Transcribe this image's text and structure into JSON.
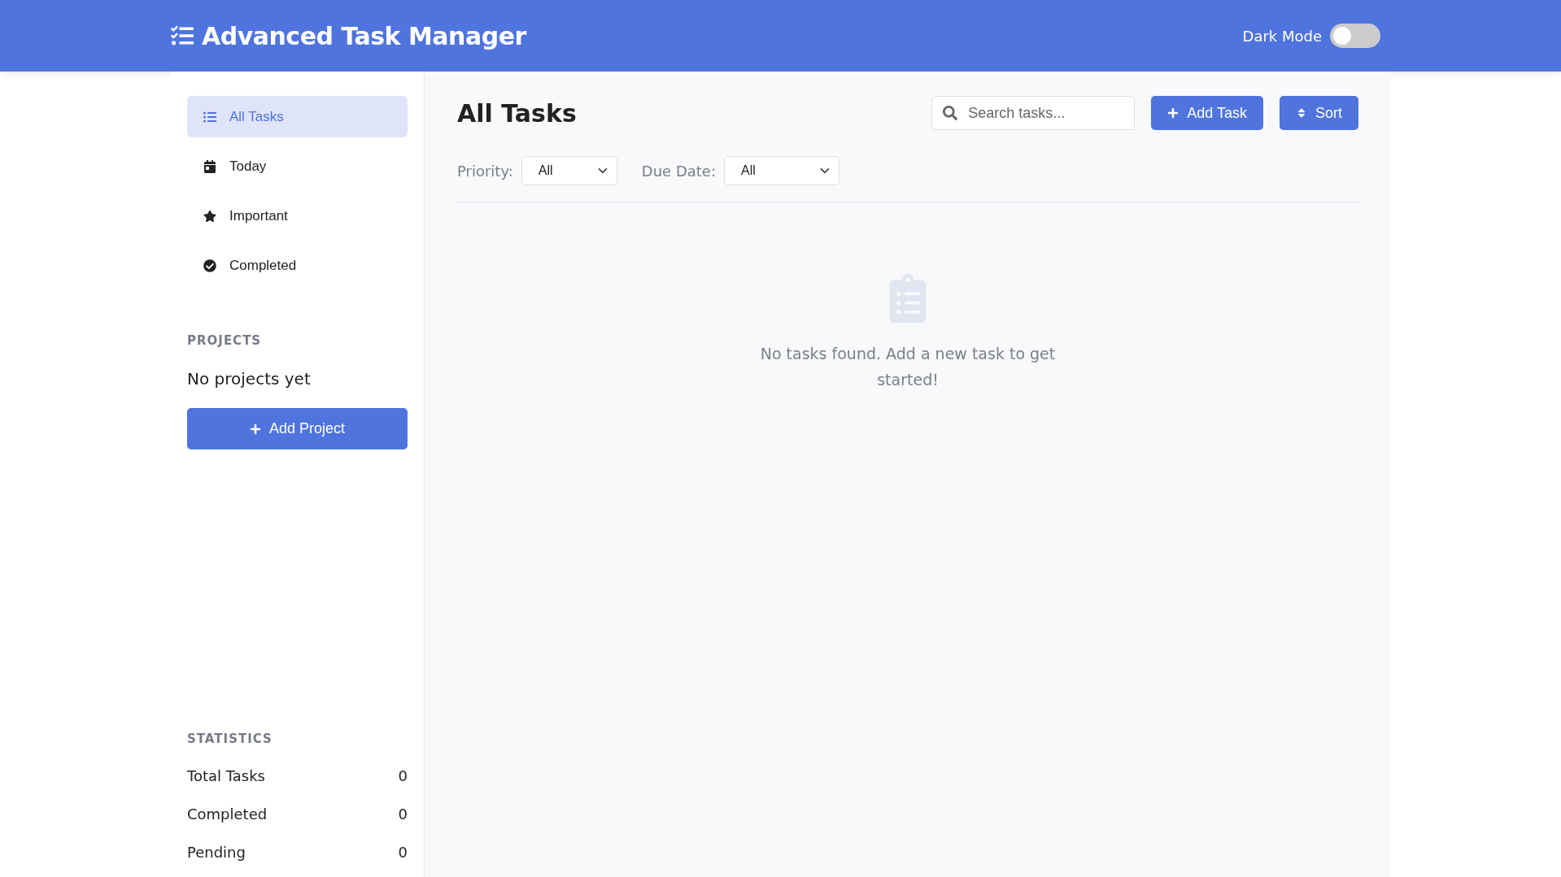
{
  "header": {
    "title": "Advanced Task Manager",
    "dark_mode": {
      "label": "Dark Mode",
      "on": false
    }
  },
  "sidebar": {
    "nav": [
      {
        "label": "All Tasks",
        "selected": true
      },
      {
        "label": "Today",
        "selected": false
      },
      {
        "label": "Important",
        "selected": false
      },
      {
        "label": "Completed",
        "selected": false
      }
    ],
    "projects": {
      "heading": "PROJECTS",
      "empty_text": "No projects yet",
      "add_button": "Add Project"
    },
    "statistics": {
      "heading": "STATISTICS",
      "rows": [
        {
          "label": "Total Tasks",
          "value": "0"
        },
        {
          "label": "Completed",
          "value": "0"
        },
        {
          "label": "Pending",
          "value": "0"
        }
      ]
    }
  },
  "main": {
    "title": "All Tasks",
    "search": {
      "placeholder": "Search tasks..."
    },
    "add_button": "Add Task",
    "sort_button": "Sort",
    "filters": [
      {
        "label": "Priority:",
        "value": "All"
      },
      {
        "label": "Due Date:",
        "value": "All"
      }
    ],
    "empty_message": "No tasks found. Add a new task to get started!"
  }
}
